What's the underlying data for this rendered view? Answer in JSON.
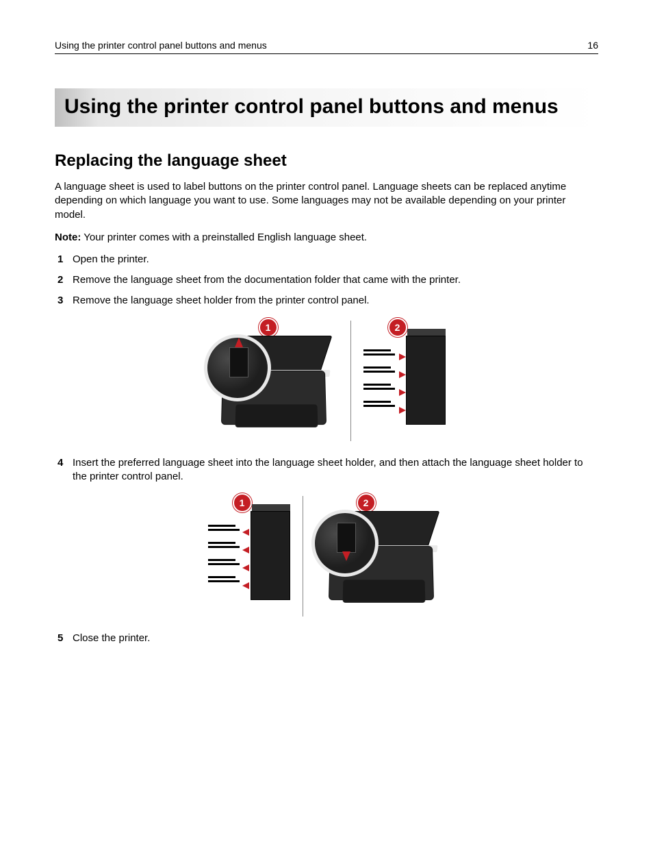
{
  "header": {
    "running_title": "Using the printer control panel buttons and menus",
    "page_number": "16"
  },
  "chapter_title": "Using the printer control panel buttons and menus",
  "section_title": "Replacing the language sheet",
  "intro_paragraph": "A language sheet is used to label buttons on the printer control panel. Language sheets can be replaced anytime depending on which language you want to use. Some languages may not be available depending on your printer model.",
  "note": {
    "label": "Note:",
    "text": " Your printer comes with a preinstalled English language sheet."
  },
  "steps": [
    "Open the printer.",
    "Remove the language sheet from the documentation folder that came with the printer.",
    "Remove the language sheet holder from the printer control panel.",
    "Insert the preferred language sheet into the language sheet holder, and then attach the language sheet holder to the printer control panel.",
    "Close the printer."
  ],
  "figure1": {
    "callouts": [
      "1",
      "2"
    ]
  },
  "figure2": {
    "callouts": [
      "1",
      "2"
    ]
  }
}
